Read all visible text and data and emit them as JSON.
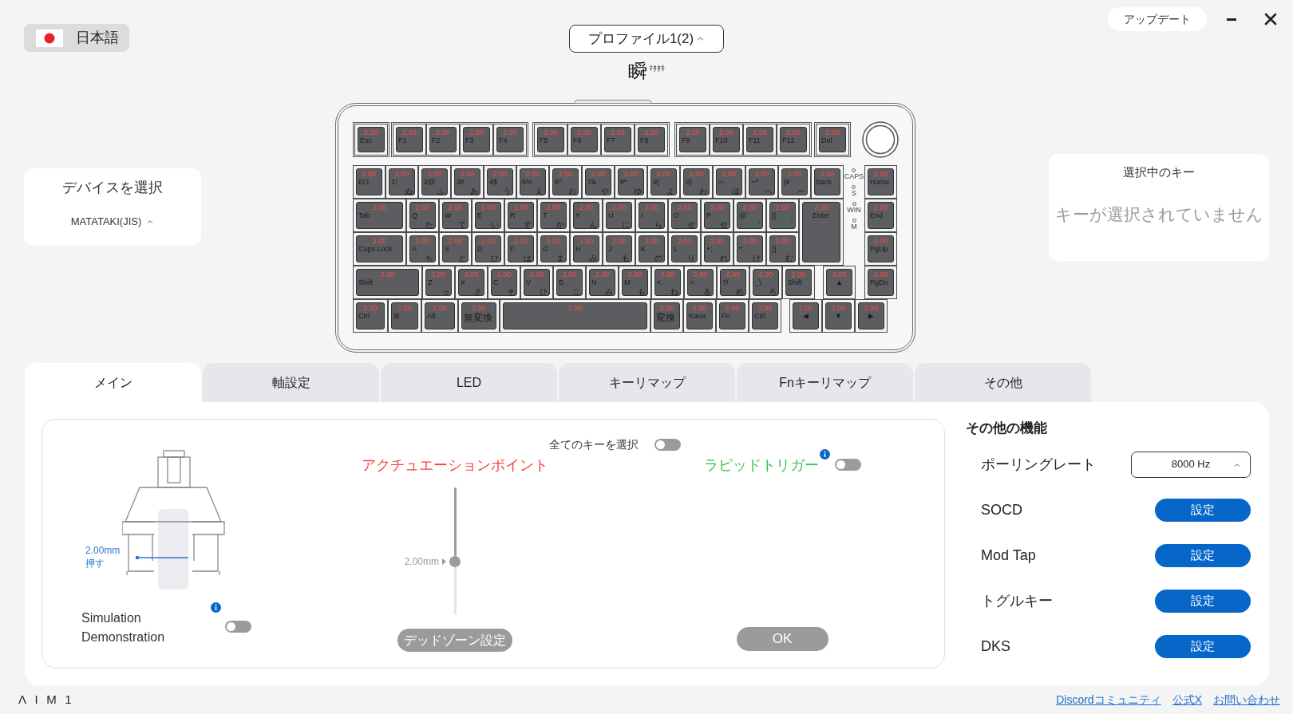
{
  "language_selector": {
    "label": "日本語"
  },
  "profile_selector": {
    "label": "プロファイル1(2)"
  },
  "logo": {
    "main": "瞬",
    "sub": "ﾏﾀﾀｷ"
  },
  "update_button": "アップデート",
  "device_panel": {
    "title": "デバイスを選択",
    "device": "MATATAKI(JIS)"
  },
  "keyboard": {
    "function_row": [
      {
        "legend": "Esc",
        "value": "2.00"
      },
      {
        "legend": "F1",
        "value": "2.00"
      },
      {
        "legend": "F2",
        "value": "2.00"
      },
      {
        "legend": "F3",
        "value": "2.00"
      },
      {
        "legend": "F4",
        "value": "2.00"
      },
      {
        "legend": "F5",
        "value": "2.00"
      },
      {
        "legend": "F6",
        "value": "2.00"
      },
      {
        "legend": "F7",
        "value": "2.00"
      },
      {
        "legend": "F8",
        "value": "2.00"
      },
      {
        "legend": "F9",
        "value": "2.00"
      },
      {
        "legend": "F10",
        "value": "2.00"
      },
      {
        "legend": "F11",
        "value": "2.00"
      },
      {
        "legend": "F12",
        "value": "2.00"
      },
      {
        "legend": "Del",
        "value": "2.00"
      }
    ],
    "number_row": [
      {
        "legend": "E/J",
        "value": "2.00"
      },
      {
        "legend": "1!",
        "kana": "ぬ",
        "value": "2.00"
      },
      {
        "legend": "2@",
        "kana": "ふ",
        "value": "2.00"
      },
      {
        "legend": "3#",
        "kana": "あ",
        "value": "2.00"
      },
      {
        "legend": "4$",
        "kana": "う",
        "value": "2.00"
      },
      {
        "legend": "5%",
        "kana": "え",
        "value": "2.00"
      },
      {
        "legend": "6^",
        "kana": "お",
        "value": "2.00"
      },
      {
        "legend": "7&",
        "kana": "や",
        "value": "2.00"
      },
      {
        "legend": "8*",
        "kana": "ゆ",
        "value": "2.00"
      },
      {
        "legend": "9(",
        "kana": "よ",
        "value": "2.00"
      },
      {
        "legend": "0)",
        "kana": "わ",
        "value": "2.00"
      },
      {
        "legend": "=-",
        "kana": "ほ",
        "value": "2.00"
      },
      {
        "legend": "~^",
        "kana": "へ",
        "value": "2.00"
      },
      {
        "legend": "|¥",
        "kana": "ー",
        "value": "2.00"
      },
      {
        "legend": "back",
        "value": "2.00"
      }
    ],
    "top_row": [
      {
        "legend": "Tab",
        "value": "2.00"
      },
      {
        "legend": "Q",
        "kana": "た",
        "value": "2.00"
      },
      {
        "legend": "W",
        "kana": "て",
        "value": "2.00"
      },
      {
        "legend": "E",
        "kana": "い",
        "value": "2.00"
      },
      {
        "legend": "R",
        "kana": "す",
        "value": "2.00"
      },
      {
        "legend": "T",
        "kana": "か",
        "value": "2.00"
      },
      {
        "legend": "Y",
        "kana": "ん",
        "value": "2.00"
      },
      {
        "legend": "U",
        "kana": "に",
        "value": "2.00"
      },
      {
        "legend": "I",
        "kana": "ら",
        "value": "2.00"
      },
      {
        "legend": "O",
        "kana": "せ",
        "value": "2.00"
      },
      {
        "legend": "P",
        "kana": "せ",
        "value": "2.00"
      },
      {
        "legend": "@`",
        "kana": "゛",
        "value": "2.00"
      },
      {
        "legend": "[{",
        "kana": "゜",
        "value": "2.00"
      }
    ],
    "enter_key": {
      "legend": "Enter",
      "value": "2.00"
    },
    "home_row": [
      {
        "legend": "Caps Lock",
        "value": "2.00"
      },
      {
        "legend": "A",
        "kana": "ち",
        "value": "2.00"
      },
      {
        "legend": "S",
        "kana": "と",
        "value": "2.00"
      },
      {
        "legend": "D",
        "kana": "ひ",
        "value": "2.00"
      },
      {
        "legend": "F",
        "kana": "は",
        "value": "2.00"
      },
      {
        "legend": "G",
        "kana": "ま",
        "value": "2.00"
      },
      {
        "legend": "H",
        "kana": "み",
        "value": "2.00"
      },
      {
        "legend": "J",
        "kana": "も",
        "value": "2.00"
      },
      {
        "legend": "K",
        "kana": "の",
        "value": "2.00"
      },
      {
        "legend": "L",
        "kana": "り",
        "value": "2.00"
      },
      {
        "legend": "+;",
        "kana": "れ",
        "value": "2.00"
      },
      {
        "legend": "*:",
        "kana": "け",
        "value": "2.00"
      },
      {
        "legend": "}]",
        "kana": "む",
        "value": "2.00"
      }
    ],
    "shift_row": [
      {
        "legend": "Shift",
        "value": "2.00"
      },
      {
        "legend": "Z",
        "kana": "っ",
        "value": "2.00"
      },
      {
        "legend": "X",
        "kana": "さ",
        "value": "2.00"
      },
      {
        "legend": "C",
        "kana": "そ",
        "value": "2.00"
      },
      {
        "legend": "V",
        "kana": "ひ",
        "value": "2.00"
      },
      {
        "legend": "B",
        "kana": "こ",
        "value": "2.00"
      },
      {
        "legend": "N",
        "kana": "み",
        "value": "2.00"
      },
      {
        "legend": "M",
        "kana": "も",
        "value": "2.00"
      },
      {
        "legend": "<,",
        "kana": "ね",
        "value": "2.00"
      },
      {
        "legend": ">.",
        "kana": "る",
        "value": "2.00"
      },
      {
        "legend": "?/",
        "kana": "め",
        "value": "2.00"
      },
      {
        "legend": "_\\",
        "kana": "ろ",
        "value": "2.00"
      },
      {
        "legend": "Shift",
        "value": "2.00"
      }
    ],
    "bottom_row": [
      {
        "legend": "Ctrl",
        "value": "2.00"
      },
      {
        "legend": "⊞",
        "value": "2.00"
      },
      {
        "legend": "Alt",
        "value": "2.00"
      },
      {
        "legend": "無変換",
        "value": "2.00"
      },
      {
        "value": "2.00"
      },
      {
        "legend": "変換",
        "value": "2.00"
      },
      {
        "legend": "Kana",
        "value": "2.00"
      },
      {
        "legend": "Fn",
        "value": "2.00"
      },
      {
        "legend": "Ctrl",
        "value": "2.00"
      }
    ],
    "indicators": [
      "CAPS",
      "S",
      "WIN",
      "M"
    ],
    "nav_keys": [
      {
        "legend": "Home",
        "value": "2.00"
      },
      {
        "legend": "End",
        "value": "2.00"
      },
      {
        "legend": "PgUp",
        "value": "2.00"
      },
      {
        "legend": "PgDn",
        "value": "2.00"
      }
    ],
    "arrow_keys": [
      {
        "legend": "▲",
        "value": "2.00"
      },
      {
        "legend": "◀",
        "value": "2.00"
      },
      {
        "legend": "▼",
        "value": "2.00"
      },
      {
        "legend": "▶",
        "value": "2.00"
      }
    ]
  },
  "selected_key_panel": {
    "title": "選択中のキー",
    "message": "キーが選択されていません"
  },
  "tabs": [
    {
      "label": "メイン",
      "selected": true
    },
    {
      "label": "軸設定",
      "selected": false
    },
    {
      "label": "LED",
      "selected": false
    },
    {
      "label": "キーリマップ",
      "selected": false
    },
    {
      "label": "Fnキーリマップ",
      "selected": false
    },
    {
      "label": "その他",
      "selected": false
    }
  ],
  "main_panel": {
    "switch_diagram": {
      "reading": "2.00mm",
      "action": "押す"
    },
    "simulation": {
      "label": "Simulation Demonstration",
      "on": false
    },
    "select_all": {
      "label": "全てのキーを選択",
      "on": false
    },
    "actuation": {
      "label": "アクチュエーションポイント",
      "reading": "2.00mm",
      "level": 0.58
    },
    "rapid_trigger": {
      "label": "ラピッドトリガー",
      "on": false
    },
    "deadzone_button": "デッドゾーン設定",
    "ok_button": "OK"
  },
  "other_functions": {
    "title": "その他の機能",
    "items": [
      {
        "kind": "select",
        "label": "ポーリングレート",
        "value": "8000 Hz"
      },
      {
        "kind": "button",
        "label": "SOCD",
        "action": "設定"
      },
      {
        "kind": "button",
        "label": "Mod Tap",
        "action": "設定"
      },
      {
        "kind": "button",
        "label": "トグルキー",
        "action": "設定"
      },
      {
        "kind": "button",
        "label": "DKS",
        "action": "設定"
      }
    ]
  },
  "footer": {
    "logo": "ΛIM1",
    "links": [
      "Discordコミュニティ",
      "公式X",
      "お問い合わせ"
    ]
  }
}
